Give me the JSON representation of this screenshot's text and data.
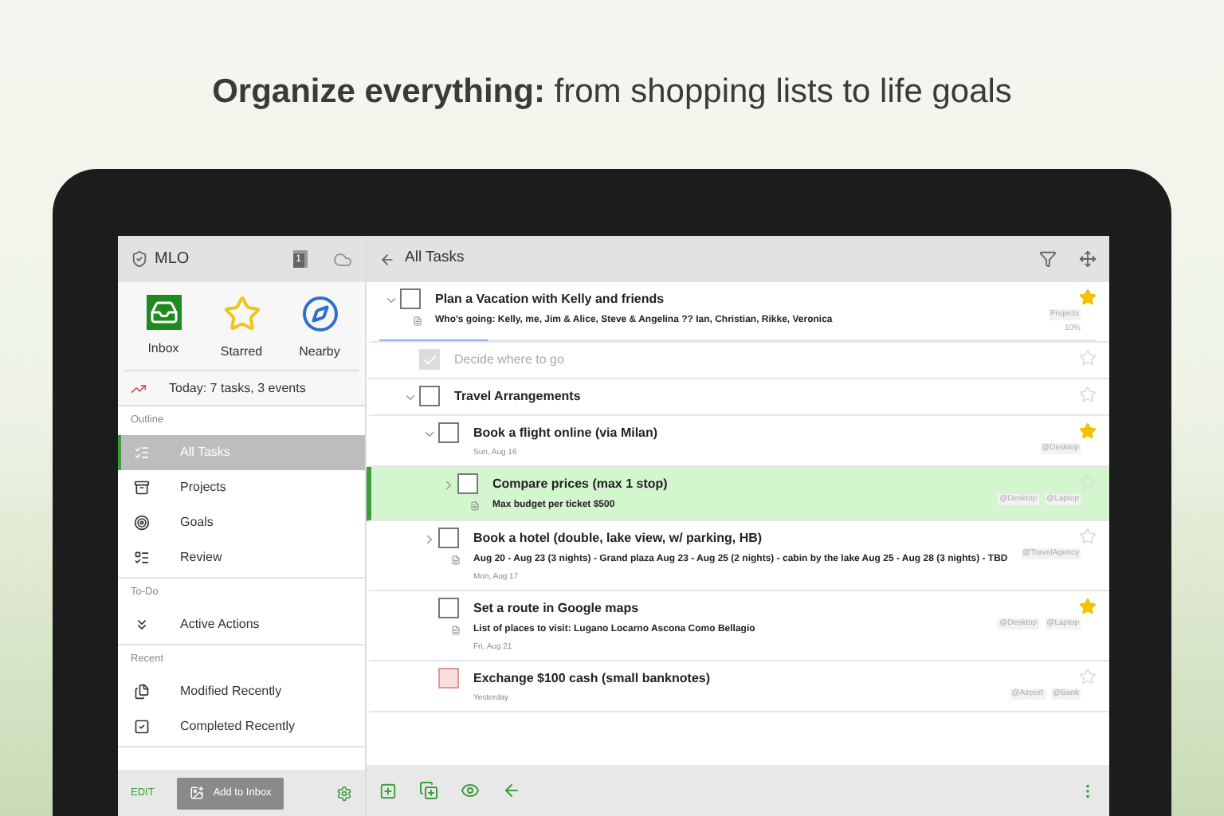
{
  "headline": "**Organize everything:** from shopping lists to life goals",
  "sidebar": {
    "app_name": "MLO",
    "badge": "1",
    "quick": [
      {
        "label": "Inbox"
      },
      {
        "label": "Starred"
      },
      {
        "label": "Nearby"
      }
    ],
    "today": "Today: 7 tasks, 3 events",
    "sections": [
      {
        "title": "Outline",
        "items": [
          {
            "label": "All Tasks",
            "selected": true
          },
          {
            "label": "Projects",
            "selected": false
          },
          {
            "label": "Goals",
            "selected": false
          },
          {
            "label": "Review",
            "selected": false
          }
        ]
      },
      {
        "title": "To-Do",
        "items": [
          {
            "label": "Active Actions",
            "selected": false
          }
        ]
      },
      {
        "title": "Recent",
        "items": [
          {
            "label": "Modified Recently",
            "selected": false
          },
          {
            "label": "Completed Recently",
            "selected": false
          }
        ]
      }
    ],
    "edit": "EDIT",
    "add_button": "Add to Inbox"
  },
  "main": {
    "title": "All Tasks",
    "tasks": [
      {
        "title": "Plan a Vacation with Kelly and friends",
        "note": "Who's going: Kelly, me, Jim & Alice, Steve & Angelina ?? Ian, Christian, Rikke, Veronica",
        "contexts": [
          "Projects"
        ],
        "progress": {
          "level": 0.15,
          "label": "10%"
        },
        "starred": true,
        "done": false,
        "overdue": false,
        "selected": false,
        "expanded": true,
        "children": [
          {
            "title": "Decide where to go",
            "starred": false,
            "done": true,
            "overdue": false,
            "selected": false
          },
          {
            "title": "Travel Arrangements",
            "starred": false,
            "done": false,
            "overdue": false,
            "selected": false,
            "expanded": true,
            "children": [
              {
                "title": "Book a flight online (via Milan)",
                "date": "Sun, Aug 16",
                "contexts": [
                  "@Desktop"
                ],
                "starred": true,
                "done": false,
                "overdue": false,
                "selected": false,
                "expanded": true,
                "children": [
                  {
                    "title": "Compare prices (max 1 stop)",
                    "note": "Max budget per ticket $500",
                    "contexts": [
                      "@Desktop",
                      "@Laptop"
                    ],
                    "starred": false,
                    "done": false,
                    "overdue": false,
                    "selected": true,
                    "expanded": false
                  }
                ]
              },
              {
                "title": "Book a hotel (double, lake view, w/ parking, HB)",
                "note": "Aug 20 - Aug 23 (3 nights) - Grand plaza Aug 23 - Aug 25 (2 nights) - cabin by the lake Aug 25 - Aug 28 (3 nights) - TBD",
                "date": "Mon, Aug 17",
                "contexts": [
                  "@TravelAgency"
                ],
                "starred": false,
                "done": false,
                "overdue": false,
                "selected": false,
                "expanded": false
              },
              {
                "title": "Set a route in Google maps",
                "note": "List of places to visit: Lugano Locarno Ascona Como Bellagio",
                "date": "Fri, Aug 21",
                "contexts": [
                  "@Desktop",
                  "@Laptop"
                ],
                "starred": true,
                "done": false,
                "overdue": false,
                "selected": false
              },
              {
                "title": "Exchange $100 cash (small banknotes)",
                "date": "Yesterday",
                "contexts": [
                  "@Airport",
                  "@Bank"
                ],
                "starred": false,
                "done": false,
                "overdue": true,
                "selected": false
              }
            ]
          }
        ]
      }
    ]
  }
}
